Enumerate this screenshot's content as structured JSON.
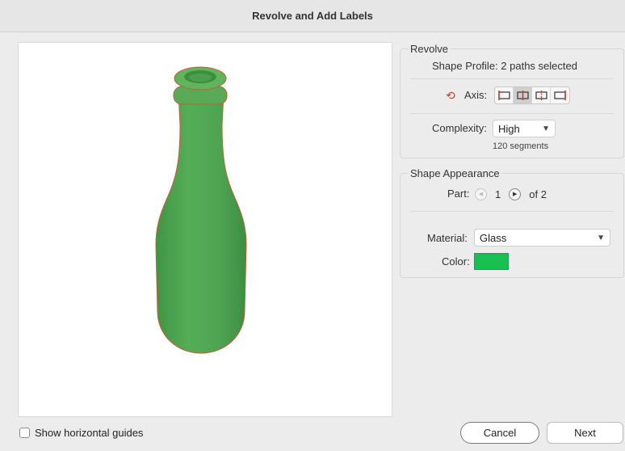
{
  "window": {
    "title": "Revolve and Add Labels"
  },
  "revolve": {
    "group_title": "Revolve",
    "shape_profile": "Shape Profile: 2 paths selected",
    "axis_label": "Axis:",
    "axis_options": [
      "axis-left-icon",
      "axis-center-icon",
      "axis-center-dashed-icon",
      "axis-right-icon"
    ],
    "axis_selected_index": 1,
    "complexity_label": "Complexity:",
    "complexity_value": "High",
    "segments_note": "120 segments"
  },
  "appearance": {
    "group_title": "Shape Appearance",
    "part_label": "Part:",
    "part_current": "1",
    "part_total": "of 2",
    "material_label": "Material:",
    "material_value": "Glass",
    "color_label": "Color:",
    "color_value": "#17c04f"
  },
  "preview": {
    "bottle_color": "#4fa551"
  },
  "footer": {
    "show_guides_label": "Show horizontal guides",
    "show_guides_checked": false,
    "cancel_label": "Cancel",
    "next_label": "Next"
  }
}
